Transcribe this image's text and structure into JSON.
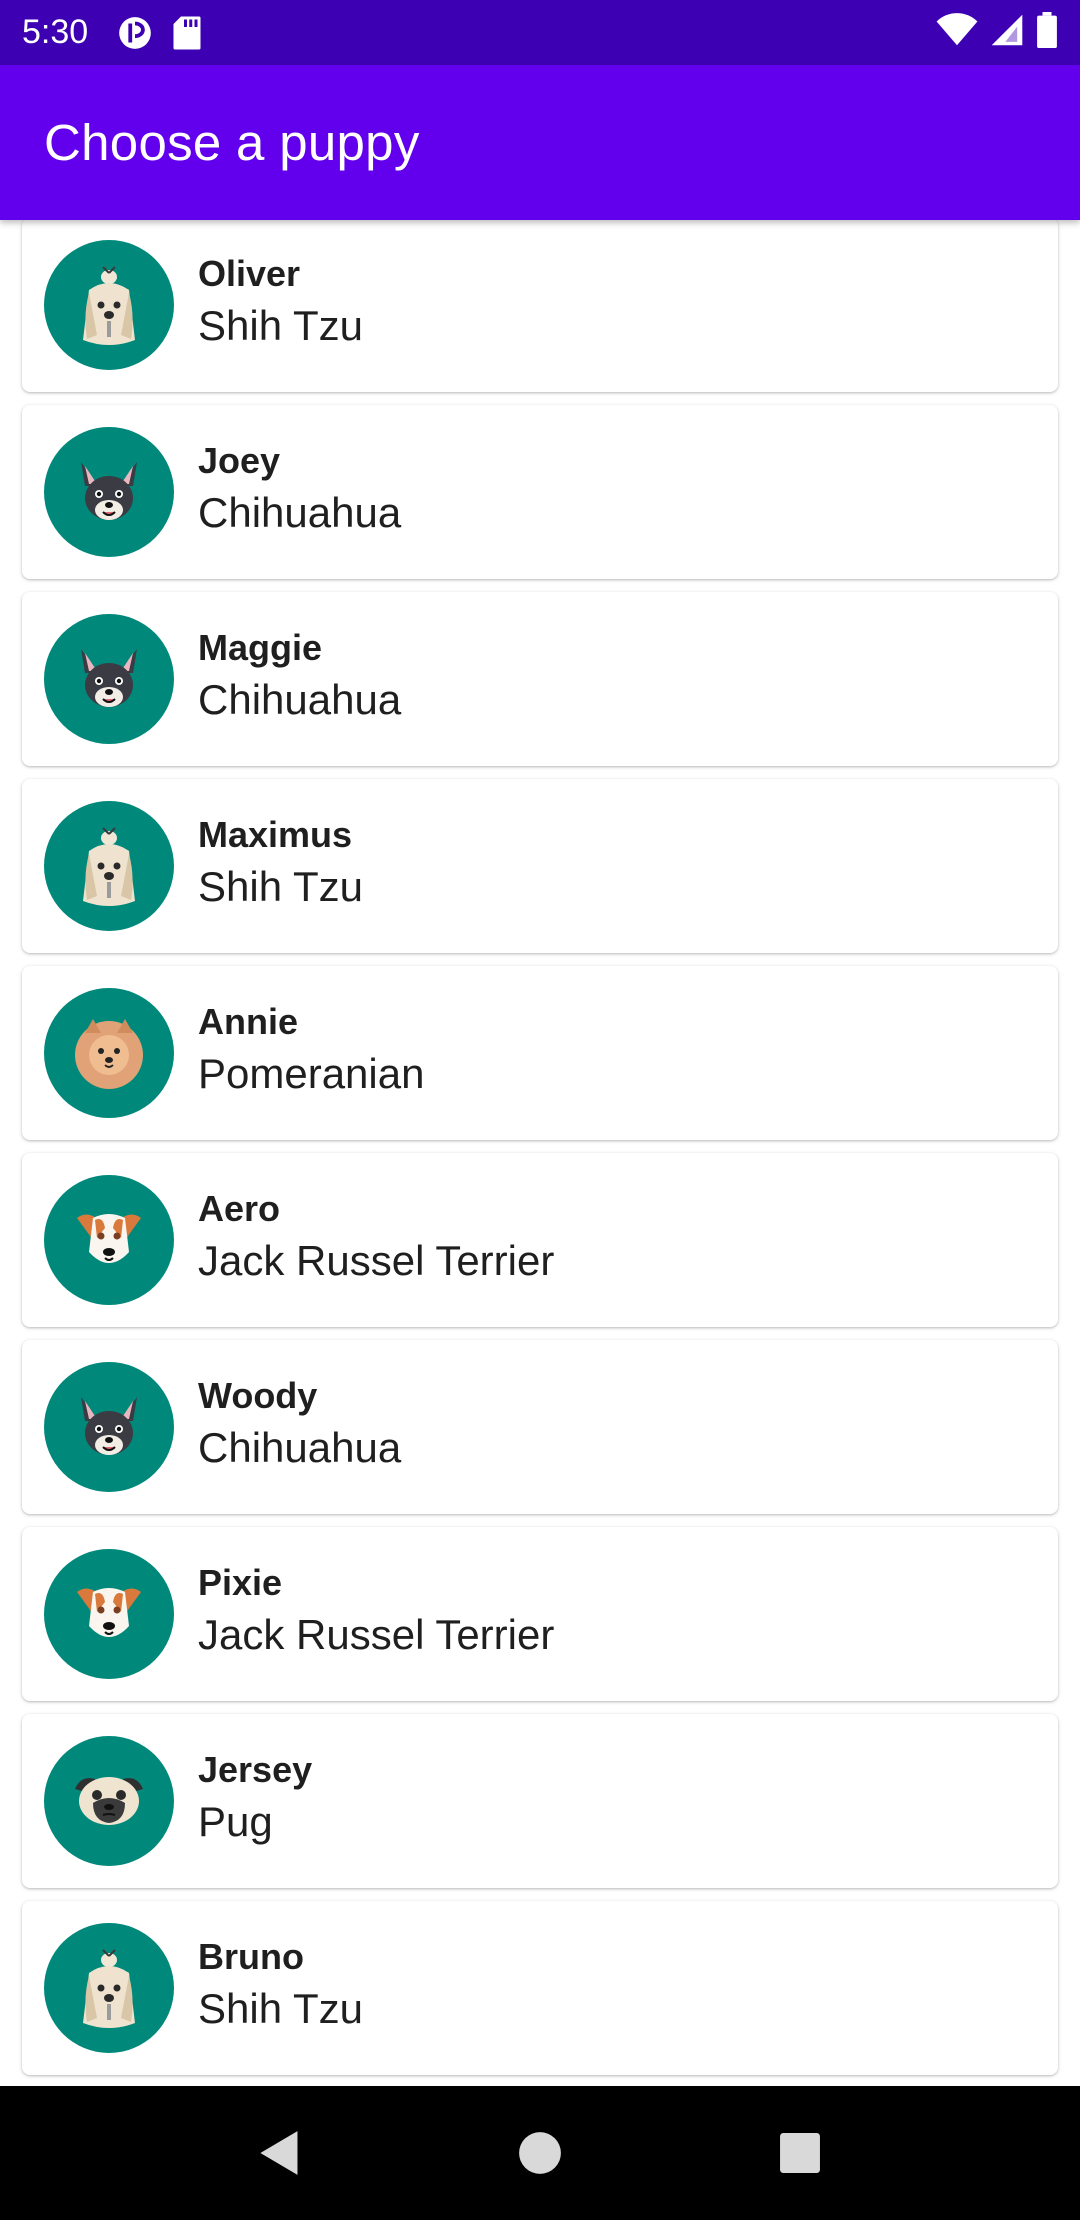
{
  "status_bar": {
    "time": "5:30",
    "left_icons": [
      "sync-icon",
      "sd-card-icon"
    ],
    "right_icons": [
      "wifi-icon",
      "signal-icon",
      "battery-icon"
    ]
  },
  "app_bar": {
    "title": "Choose a puppy",
    "color": "#6200ee"
  },
  "puppies": [
    {
      "name": "Oliver",
      "breed": "Shih Tzu",
      "avatar": "shih-tzu"
    },
    {
      "name": "Joey",
      "breed": "Chihuahua",
      "avatar": "chihuahua"
    },
    {
      "name": "Maggie",
      "breed": "Chihuahua",
      "avatar": "chihuahua"
    },
    {
      "name": "Maximus",
      "breed": "Shih Tzu",
      "avatar": "shih-tzu"
    },
    {
      "name": "Annie",
      "breed": "Pomeranian",
      "avatar": "pomeranian"
    },
    {
      "name": "Aero",
      "breed": "Jack Russel Terrier",
      "avatar": "jack-russel"
    },
    {
      "name": "Woody",
      "breed": "Chihuahua",
      "avatar": "chihuahua"
    },
    {
      "name": "Pixie",
      "breed": "Jack Russel Terrier",
      "avatar": "jack-russel"
    },
    {
      "name": "Jersey",
      "breed": "Pug",
      "avatar": "pug"
    },
    {
      "name": "Bruno",
      "breed": "Shih Tzu",
      "avatar": "shih-tzu"
    }
  ],
  "colors": {
    "status_bar": "#3d00b3",
    "avatar_background": "#00897b"
  },
  "nav_bar": {
    "buttons": [
      "back-icon",
      "home-icon",
      "recents-icon"
    ]
  }
}
